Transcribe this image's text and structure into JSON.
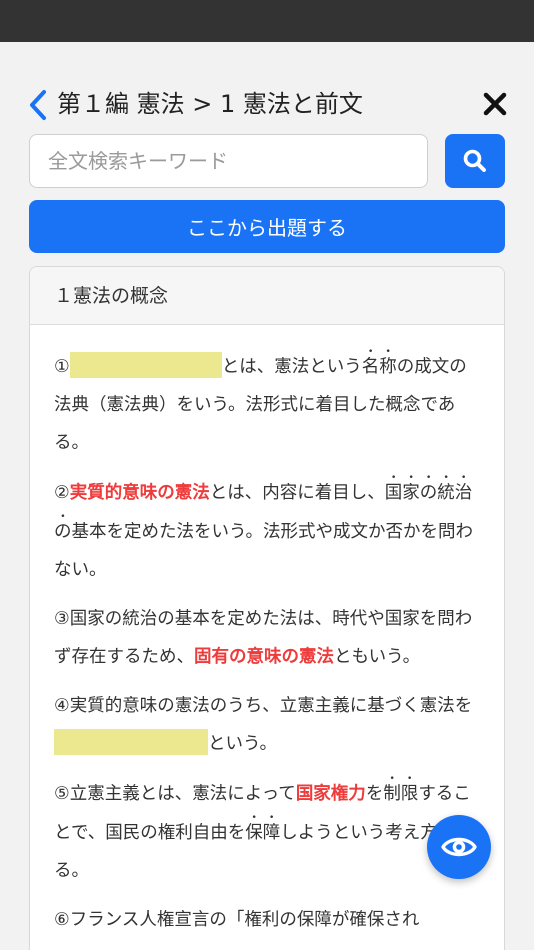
{
  "header": {
    "breadcrumb": "第１編 憲法 > 1 憲法と前文"
  },
  "search": {
    "placeholder": "全文検索キーワード"
  },
  "actions": {
    "start_quiz_label": "ここから出題する"
  },
  "section": {
    "title": "１憲法の概念",
    "paragraphs": [
      {
        "num": "①",
        "before": "",
        "after_blank": "とは、憲法という",
        "emph": "名称",
        "tail": "の成文の法典（憲法典）をいう。法形式に着目した概念である。"
      },
      {
        "num": "②",
        "keyword": "実質的意味の憲法",
        "t1": "とは、内容に着目し、",
        "emph1": "国家の",
        "emph2": "統治の",
        "t2": "基本を定めた法をいう。法形式や成文か否かを問わない。"
      },
      {
        "num": "③",
        "t1": "国家の統治の基本を定めた法は、時代や国家を問わず存在するため、",
        "keyword": "固有の意味の憲法",
        "t2": "ともいう。"
      },
      {
        "num": "④",
        "t1": "実質的意味の憲法のうち、立憲主義に基づく憲法を",
        "t2": "という。"
      },
      {
        "num": "⑤",
        "t1": "立憲主義とは、憲法によって",
        "keyword": "国家権力",
        "t2": "を",
        "emph1": "制限",
        "t3": "することで、国民の権利自由を",
        "emph2": "保障",
        "t4": "しようという考え方である。"
      },
      {
        "num": "⑥",
        "t1": "フランス人権宣言の「権利の保障が確保され"
      }
    ]
  },
  "colors": {
    "accent": "#1a73f5",
    "keyword": "#ee3b3b",
    "blank": "#ece88f"
  },
  "icons": [
    "chevron-left-icon",
    "close-icon",
    "search-icon",
    "eye-icon"
  ]
}
